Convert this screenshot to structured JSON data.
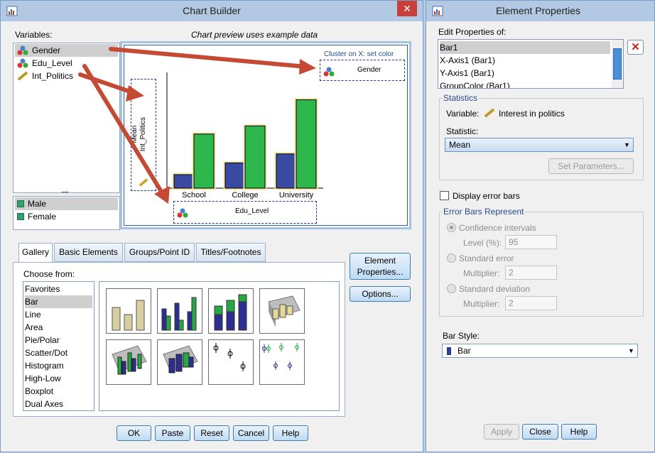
{
  "chart_builder": {
    "title": "Chart Builder",
    "close_glyph": "✕",
    "variables_label": "Variables:",
    "preview_note": "Chart preview uses example data",
    "variables": [
      {
        "name": "Gender",
        "icon": "nominal-icon"
      },
      {
        "name": "Edu_Level",
        "icon": "nominal-icon"
      },
      {
        "name": "Int_Politics",
        "icon": "scale-icon"
      }
    ],
    "categories": [
      "Male",
      "Female"
    ],
    "preview": {
      "cluster_label": "Cluster on X: set color",
      "cluster_var": "Gender",
      "y_label": "Mean",
      "y_var": "Int_Politics",
      "x_var": "Edu_Level"
    },
    "tabs": [
      "Gallery",
      "Basic Elements",
      "Groups/Point ID",
      "Titles/Footnotes"
    ],
    "choose_from_label": "Choose from:",
    "chart_types": [
      "Favorites",
      "Bar",
      "Line",
      "Area",
      "Pie/Polar",
      "Scatter/Dot",
      "Histogram",
      "High-Low",
      "Boxplot",
      "Dual Axes"
    ],
    "side_buttons": {
      "element_properties": "Element Properties...",
      "options": "Options..."
    },
    "bottom_buttons": [
      "OK",
      "Paste",
      "Reset",
      "Cancel",
      "Help"
    ]
  },
  "chart_data": {
    "type": "bar",
    "categories": [
      "School",
      "College",
      "University"
    ],
    "series": [
      {
        "values": [
          1.5,
          2.8,
          3.8
        ]
      },
      {
        "values": [
          6.0,
          6.9,
          9.8
        ]
      }
    ],
    "colors": [
      "#3b4aa1",
      "#2eb84b"
    ],
    "ylim": [
      0,
      10
    ]
  },
  "element_properties": {
    "title": "Element Properties",
    "edit_label": "Edit Properties of:",
    "elements": [
      "Bar1",
      "X-Axis1 (Bar1)",
      "Y-Axis1 (Bar1)",
      "GroupColor (Bar1)"
    ],
    "statistics_title": "Statistics",
    "variable_label": "Variable:",
    "variable_value": "Interest in politics",
    "statistic_label": "Statistic:",
    "statistic_value": "Mean",
    "set_parameters": "Set Parameters...",
    "display_error_bars": "Display error bars",
    "error_bars_title": "Error Bars Represent",
    "ci_label": "Confidence intervals",
    "level_label": "Level (%):",
    "level_value": "95",
    "se_label": "Standard error",
    "se_mult_label": "Multiplier:",
    "se_mult_value": "2",
    "sd_label": "Standard deviation",
    "sd_mult_label": "Multiplier:",
    "sd_mult_value": "2",
    "bar_style_label": "Bar Style:",
    "bar_style_value": "Bar",
    "buttons": [
      "Apply",
      "Close",
      "Help"
    ]
  }
}
